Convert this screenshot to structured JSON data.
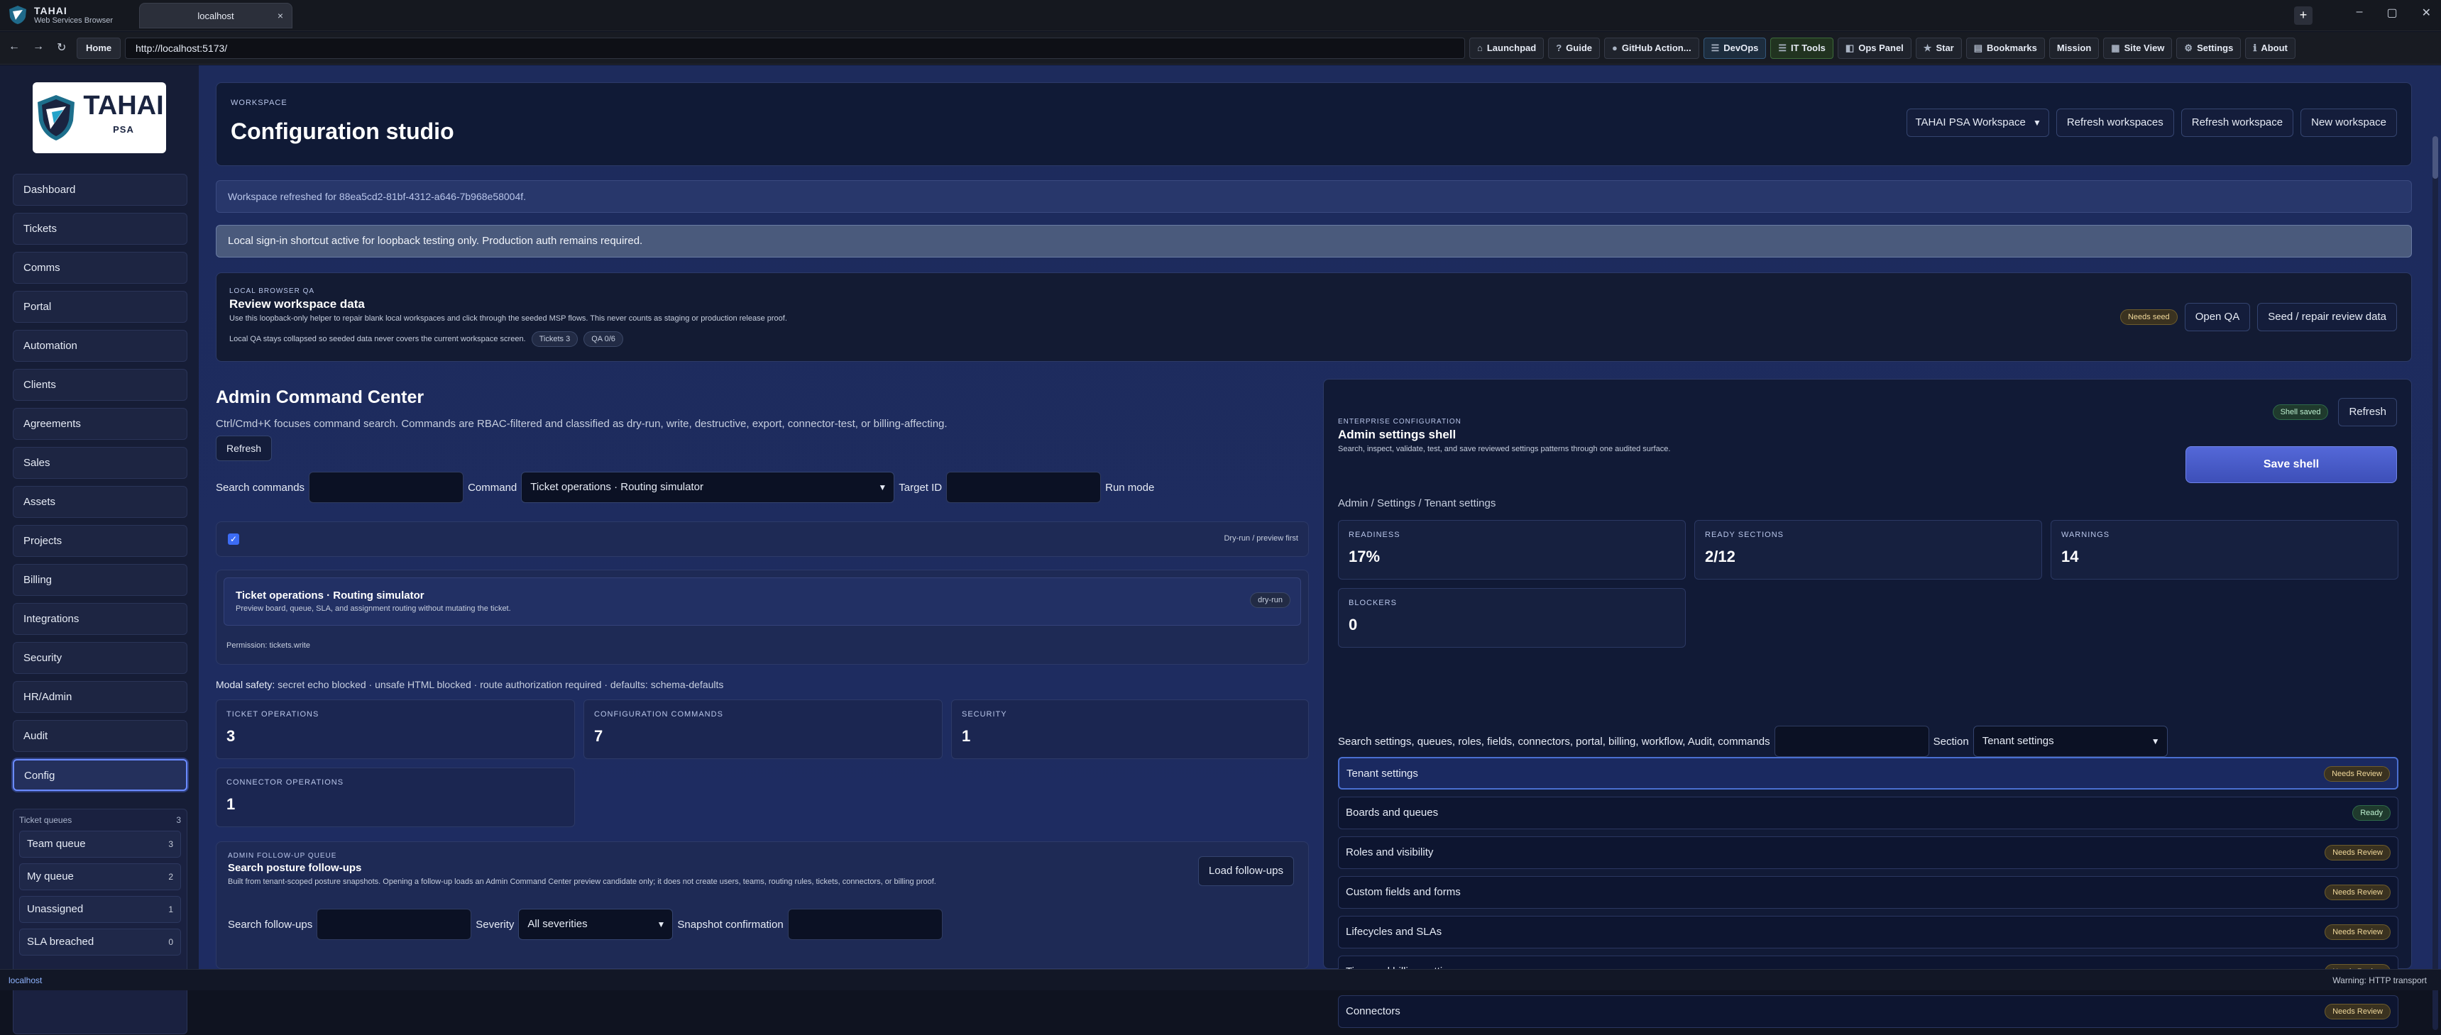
{
  "browser": {
    "brand_title": "TAHAI",
    "brand_subtitle": "Web Services Browser",
    "tab_title": "localhost",
    "tab_close": "×",
    "new_tab": "+",
    "win_min": "–",
    "win_max": "▢",
    "win_close": "✕",
    "back": "←",
    "forward": "→",
    "reload": "↻",
    "home": "Home",
    "url": "http://localhost:5173/",
    "toolbar": [
      {
        "icon": "⌂",
        "label": "Launchpad"
      },
      {
        "icon": "?",
        "label": "Guide"
      },
      {
        "icon": "●",
        "label": "GitHub Action..."
      },
      {
        "icon": "☰",
        "label": "DevOps"
      },
      {
        "icon": "☰",
        "label": "IT Tools"
      },
      {
        "icon": "◧",
        "label": "Ops Panel"
      },
      {
        "icon": "★",
        "label": "Star"
      },
      {
        "icon": "▤",
        "label": "Bookmarks"
      },
      {
        "icon": "",
        "label": "Mission"
      },
      {
        "icon": "▦",
        "label": "Site View"
      },
      {
        "icon": "⚙",
        "label": "Settings"
      },
      {
        "icon": "ℹ",
        "label": "About"
      }
    ]
  },
  "sidebar": {
    "logo_text": "TAHAI",
    "logo_sub": "PSA",
    "items": [
      "Dashboard",
      "Tickets",
      "Comms",
      "Portal",
      "Automation",
      "Clients",
      "Agreements",
      "Sales",
      "Assets",
      "Projects",
      "Billing",
      "Integrations",
      "Security",
      "HR/Admin",
      "Audit",
      "Config"
    ],
    "active": "Config",
    "queues_title": "Ticket queues",
    "queues_count": "3",
    "queues": [
      {
        "label": "Team queue",
        "count": "3"
      },
      {
        "label": "My queue",
        "count": "2"
      },
      {
        "label": "Unassigned",
        "count": "1"
      },
      {
        "label": "SLA breached",
        "count": "0"
      }
    ]
  },
  "header": {
    "eyebrow": "Workspace",
    "title": "Configuration studio",
    "workspace_select": "TAHAI PSA Workspace",
    "refresh_workspaces": "Refresh workspaces",
    "refresh_workspace": "Refresh workspace",
    "new_workspace": "New workspace"
  },
  "notices": {
    "refreshed": "Workspace refreshed for 88ea5cd2-81bf-4312-a646-7b968e58004f.",
    "signin": "Local sign-in shortcut active for loopback testing only. Production auth remains required."
  },
  "qa": {
    "eyebrow": "Local browser QA",
    "title": "Review workspace data",
    "desc": "Use this loopback-only helper to repair blank local workspaces and click through the seeded MSP flows. This never counts as staging or production release proof.",
    "note": "Local QA stays collapsed so seeded data never covers the current workspace screen.",
    "chip_tickets": "Tickets 3",
    "chip_qa": "QA 0/6",
    "status": "Needs seed",
    "open_qa": "Open QA",
    "seed": "Seed / repair review data"
  },
  "acc": {
    "title": "Admin Command Center",
    "sub": "Ctrl/Cmd+K focuses command search. Commands are RBAC-filtered and classified as dry-run, write, destructive, export, connector-test, or billing-affecting.",
    "refresh": "Refresh",
    "search_label": "Search commands",
    "command_label": "Command",
    "command_value": "Ticket operations · Routing simulator",
    "target_label": "Target ID",
    "run_mode_label": "Run mode",
    "dry_run_note": "Dry-run / preview first",
    "preview_title": "Ticket operations · Routing simulator",
    "preview_desc": "Preview board, queue, SLA, and assignment routing without mutating the ticket.",
    "preview_chip": "dry-run",
    "permission": "Permission: tickets.write",
    "safety_label": "Modal safety:",
    "safety_text": " secret echo blocked · unsafe HTML blocked · route authorization required · defaults: schema-defaults",
    "metrics": [
      {
        "label": "TICKET OPERATIONS",
        "value": "3"
      },
      {
        "label": "CONFIGURATION COMMANDS",
        "value": "7"
      },
      {
        "label": "SECURITY",
        "value": "1"
      },
      {
        "label": "CONNECTOR OPERATIONS",
        "value": "1"
      }
    ],
    "follow_eyebrow": "Admin follow-up queue",
    "follow_title": "Search posture follow-ups",
    "follow_desc": "Built from tenant-scoped posture snapshots. Opening a follow-up loads an Admin Command Center preview candidate only; it does not create users, teams, routing rules, tickets, connectors, or billing proof.",
    "load_followups": "Load follow-ups",
    "search_followups": "Search follow-ups",
    "severity_label": "Severity",
    "severity_value": "All severities",
    "snapshot_label": "Snapshot confirmation"
  },
  "ent": {
    "eyebrow": "Enterprise configuration",
    "title": "Admin settings shell",
    "desc": "Search, inspect, validate, test, and save reviewed settings patterns through one audited surface.",
    "shell_chip": "Shell saved",
    "refresh": "Refresh",
    "save": "Save shell",
    "crumb": "Admin / Settings / Tenant settings",
    "metrics": [
      {
        "label": "READINESS",
        "value": "17%"
      },
      {
        "label": "READY SECTIONS",
        "value": "2/12"
      },
      {
        "label": "WARNINGS",
        "value": "14"
      },
      {
        "label": "BLOCKERS",
        "value": "0"
      }
    ],
    "search_label": "Search settings, queues, roles, fields, connectors, portal, billing, workflow, Audit, commands",
    "section_label": "Section",
    "section_value": "Tenant settings",
    "sections": [
      {
        "label": "Tenant settings",
        "status": "Needs Review"
      },
      {
        "label": "Boards and queues",
        "status": "Ready"
      },
      {
        "label": "Roles and visibility",
        "status": "Needs Review"
      },
      {
        "label": "Custom fields and forms",
        "status": "Needs Review"
      },
      {
        "label": "Lifecycles and SLAs",
        "status": "Needs Review"
      },
      {
        "label": "Time and billing settings",
        "status": "Needs Review"
      },
      {
        "label": "Connectors",
        "status": "Needs Review"
      }
    ]
  },
  "status": {
    "left": "localhost",
    "right": "Warning: HTTP transport"
  }
}
